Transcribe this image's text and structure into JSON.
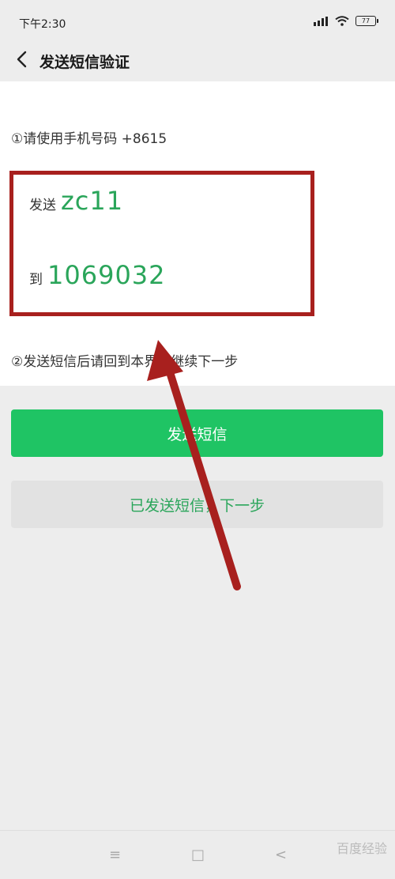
{
  "status_bar": {
    "time": "下午2:30",
    "battery_level": "77"
  },
  "header": {
    "title": "发送短信验证"
  },
  "instructions": {
    "step1": "①请使用手机号码 +8615",
    "step2": "②发送短信后请回到本界面继续下一步"
  },
  "sms_info": {
    "send_label": "发送",
    "send_code": "zc11",
    "to_label": "到",
    "to_number": "1069032"
  },
  "buttons": {
    "send_sms": "发送短信",
    "sent_next": "已发送短信，下一步"
  },
  "bottom_nav": {
    "menu_icon": "≡",
    "home_icon": "□",
    "back_icon": "<"
  },
  "watermark": "百度经验",
  "colors": {
    "accent_green": "#1fc464",
    "text_green": "#2aa55a",
    "annotation_red": "#a8201e"
  }
}
